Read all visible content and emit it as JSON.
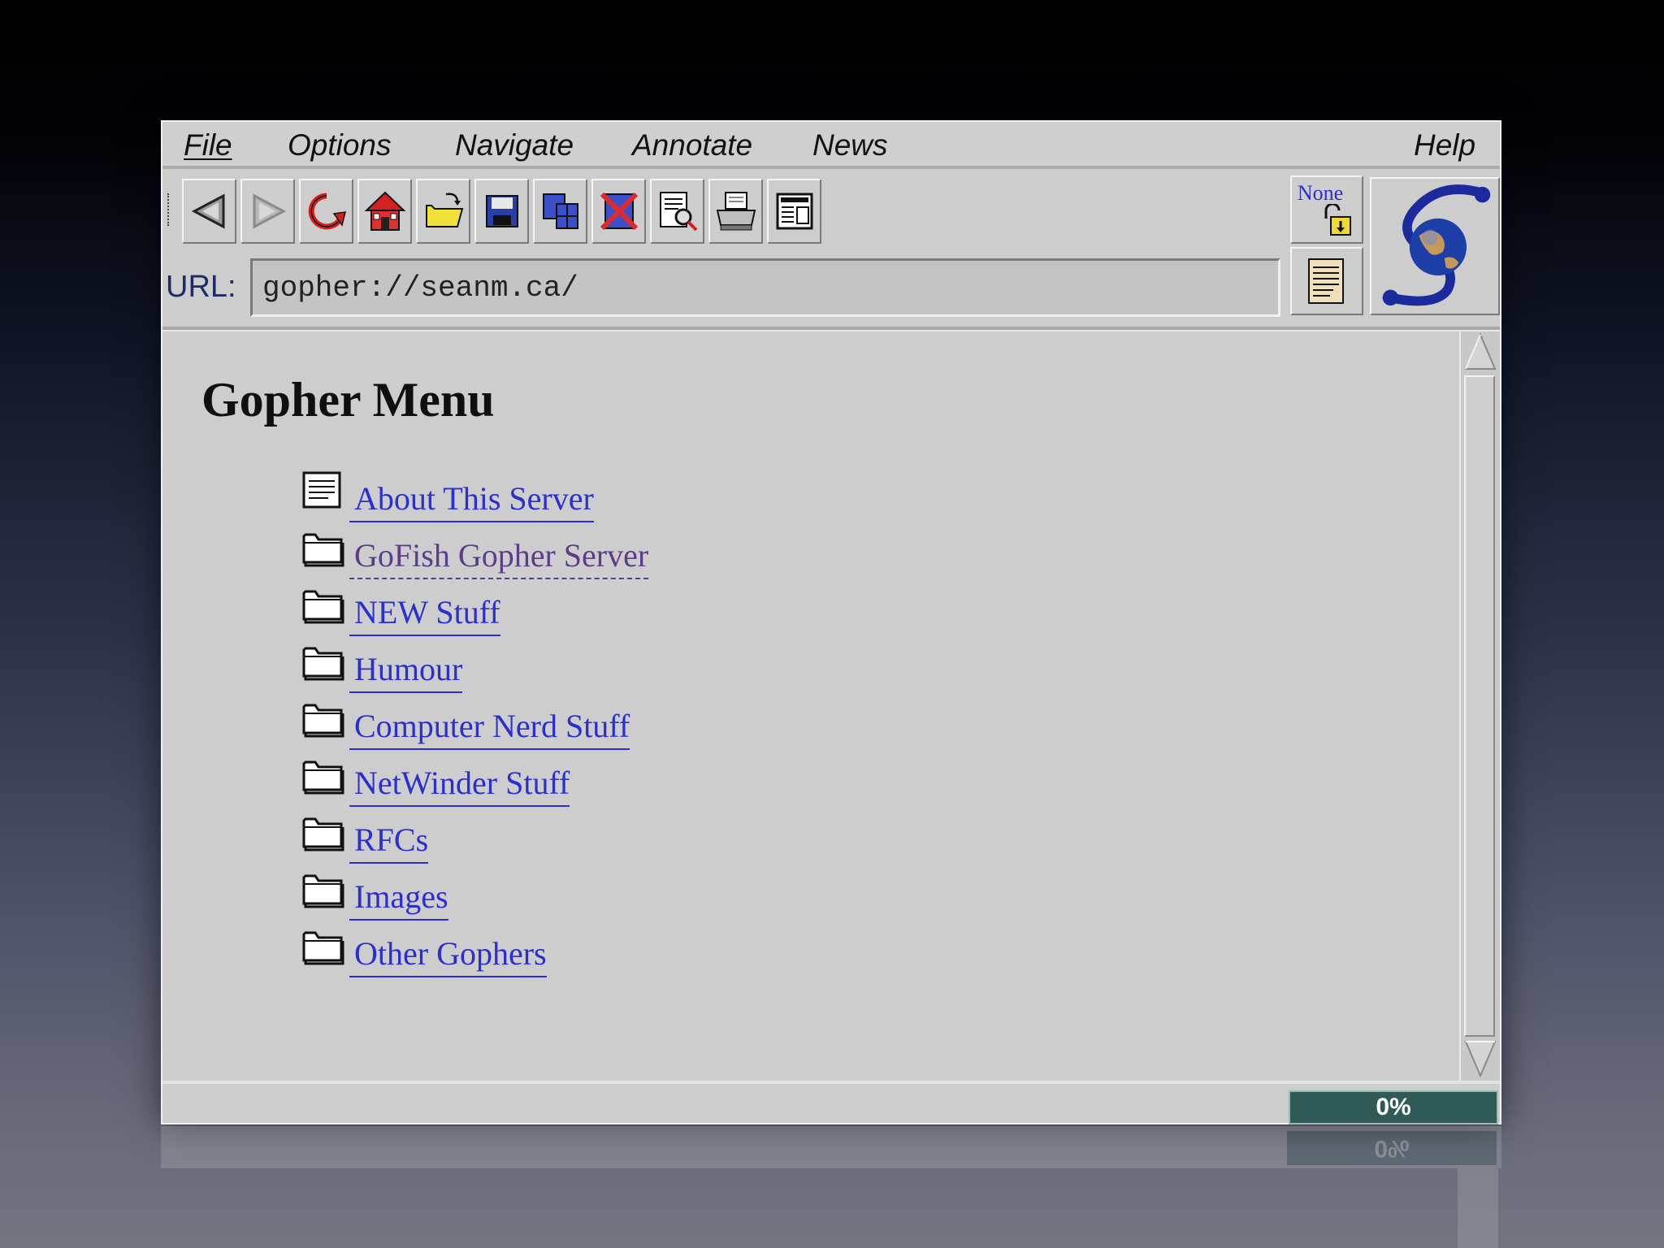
{
  "menubar": {
    "file": "File",
    "options": "Options",
    "navigate": "Navigate",
    "annotate": "Annotate",
    "news": "News",
    "help": "Help"
  },
  "toolbar": {
    "buttons": [
      "back-icon",
      "forward-icon",
      "reload-icon",
      "home-icon",
      "open-icon",
      "save-icon",
      "clone-window-icon",
      "close-window-icon",
      "find-icon",
      "print-icon",
      "news-icon"
    ],
    "security_label": "None"
  },
  "url": {
    "label": "URL:",
    "value": "gopher://seanm.ca/"
  },
  "page": {
    "title": "Gopher Menu",
    "items": [
      {
        "label": "About This Server",
        "icon": "text-document-icon"
      },
      {
        "label": "GoFish Gopher Server",
        "icon": "folder-icon"
      },
      {
        "label": "NEW Stuff",
        "icon": "folder-icon"
      },
      {
        "label": "Humour",
        "icon": "folder-icon"
      },
      {
        "label": "Computer Nerd Stuff",
        "icon": "folder-icon"
      },
      {
        "label": "NetWinder Stuff",
        "icon": "folder-icon"
      },
      {
        "label": "RFCs",
        "icon": "folder-icon"
      },
      {
        "label": "Images",
        "icon": "folder-icon"
      },
      {
        "label": "Other Gophers",
        "icon": "folder-icon"
      }
    ]
  },
  "status": {
    "text": "",
    "progress": "0%"
  },
  "reflection": {
    "progress": "0%"
  },
  "colors": {
    "link": "#2b2fd0",
    "visited_link": "#5b3d8a",
    "progress_bg": "#2f5a55"
  }
}
